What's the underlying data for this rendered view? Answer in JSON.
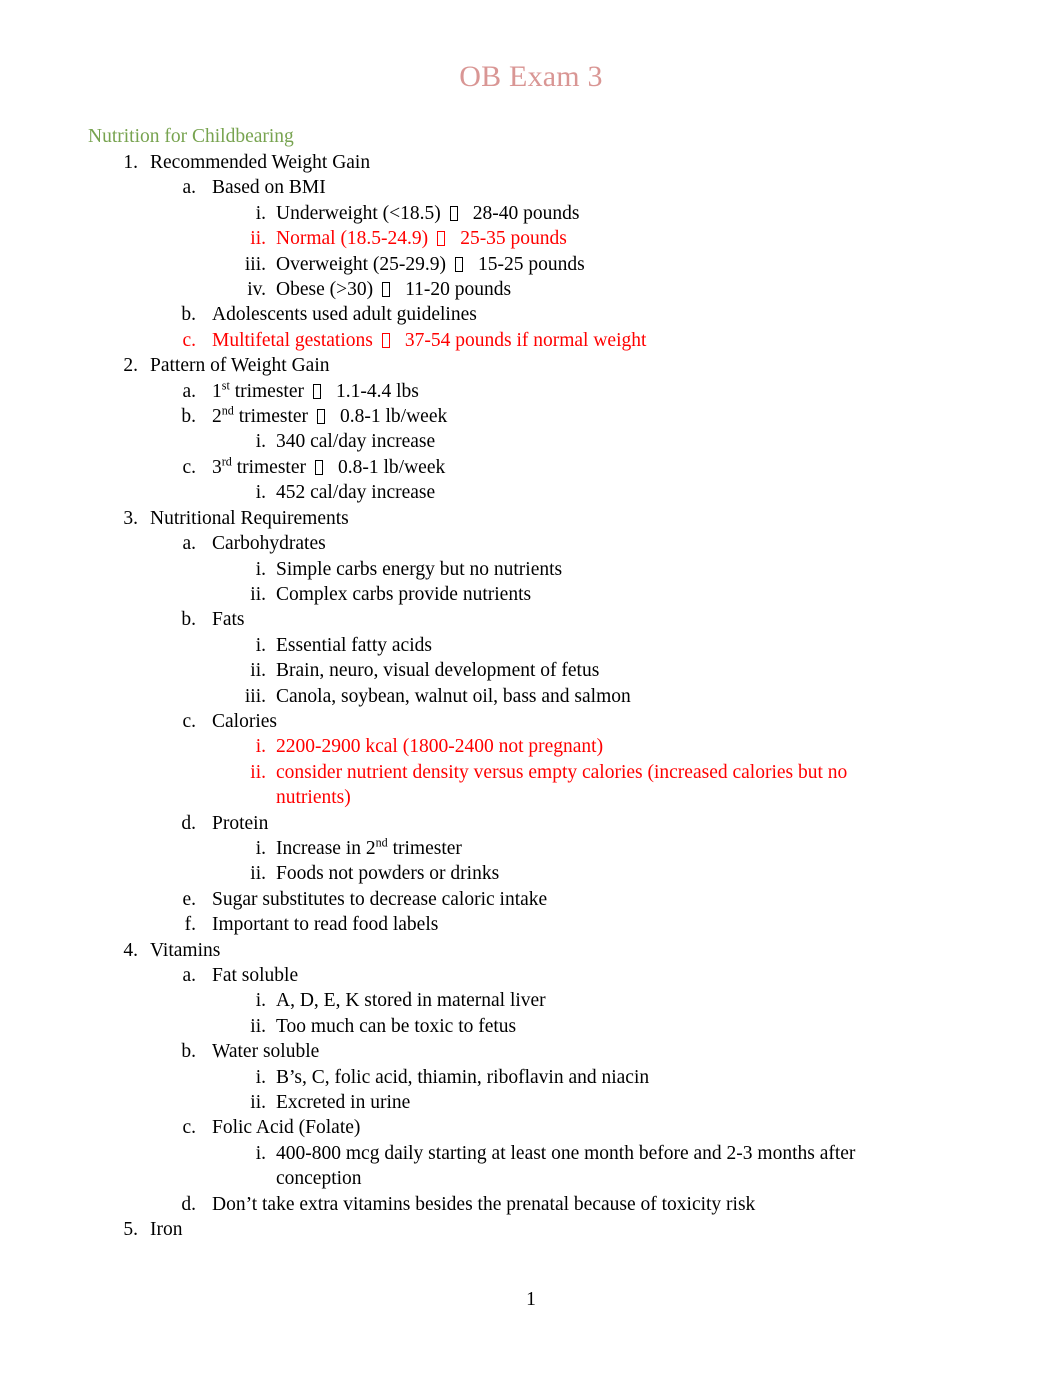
{
  "document": {
    "title": "OB Exam 3",
    "title_color": "#d99694",
    "heading_color": "#77a34f",
    "highlight_color": "#ff0000",
    "page_number": "1"
  },
  "heading": {
    "text": "Nutrition for Childbearing"
  },
  "arrow_glyph": {
    "name": "missing-glyph-box",
    "description": "unrenderable Wingdings arrow shown as empty box"
  },
  "outline": [
    {
      "marker": "1.",
      "level": 1,
      "text": "Recommended Weight Gain",
      "color": "black",
      "children": [
        {
          "marker": "a.",
          "level": 2,
          "text": "Based on BMI",
          "color": "black",
          "children": [
            {
              "marker": "i.",
              "level": 3,
              "color": "black",
              "before_arrow": "Underweight (<18.5)",
              "after_arrow": "28-40 pounds"
            },
            {
              "marker": "ii.",
              "level": 3,
              "color": "red",
              "before_arrow": "Normal (18.5-24.9)",
              "after_arrow": "25-35 pounds"
            },
            {
              "marker": "iii.",
              "level": 3,
              "color": "black",
              "before_arrow": "Overweight (25-29.9)",
              "after_arrow": "15-25 pounds"
            },
            {
              "marker": "iv.",
              "level": 3,
              "color": "black",
              "before_arrow": "Obese (>30)",
              "after_arrow": "11-20 pounds"
            }
          ]
        },
        {
          "marker": "b.",
          "level": 2,
          "text": "Adolescents used adult guidelines",
          "color": "black"
        },
        {
          "marker": "c.",
          "level": 2,
          "color": "red",
          "before_arrow": "Multifetal gestations",
          "after_arrow": "37-54 pounds if normal weight"
        }
      ]
    },
    {
      "marker": "2.",
      "level": 1,
      "text": "Pattern of Weight Gain",
      "color": "black",
      "children": [
        {
          "marker": "a.",
          "level": 2,
          "color": "black",
          "ordinal_base": "1",
          "ordinal_sup": "st",
          "before_arrow": " trimester",
          "after_arrow": "1.1-4.4 lbs"
        },
        {
          "marker": "b.",
          "level": 2,
          "color": "black",
          "ordinal_base": "2",
          "ordinal_sup": "nd",
          "before_arrow": " trimester",
          "after_arrow": "0.8-1 lb/week",
          "children": [
            {
              "marker": "i.",
              "level": 3,
              "text": "340 cal/day increase",
              "color": "black"
            }
          ]
        },
        {
          "marker": "c.",
          "level": 2,
          "color": "black",
          "ordinal_base": "3",
          "ordinal_sup": "rd",
          "before_arrow": " trimester",
          "after_arrow": "0.8-1 lb/week",
          "children": [
            {
              "marker": "i.",
              "level": 3,
              "text": "452 cal/day increase",
              "color": "black"
            }
          ]
        }
      ]
    },
    {
      "marker": "3.",
      "level": 1,
      "text": "Nutritional Requirements",
      "color": "black",
      "children": [
        {
          "marker": "a.",
          "level": 2,
          "text": "Carbohydrates",
          "color": "black",
          "children": [
            {
              "marker": "i.",
              "level": 3,
              "text": "Simple carbs energy but no nutrients",
              "color": "black"
            },
            {
              "marker": "ii.",
              "level": 3,
              "text": "Complex carbs provide nutrients",
              "color": "black"
            }
          ]
        },
        {
          "marker": "b.",
          "level": 2,
          "text": "Fats",
          "color": "black",
          "children": [
            {
              "marker": "i.",
              "level": 3,
              "text": "Essential fatty acids",
              "color": "black"
            },
            {
              "marker": "ii.",
              "level": 3,
              "text": "Brain, neuro, visual development of fetus",
              "color": "black"
            },
            {
              "marker": "iii.",
              "level": 3,
              "text": "Canola, soybean, walnut oil, bass and salmon",
              "color": "black"
            }
          ]
        },
        {
          "marker": "c.",
          "level": 2,
          "text": "Calories",
          "color": "black",
          "children": [
            {
              "marker": "i.",
              "level": 3,
              "text": "2200-2900 kcal (1800-2400 not pregnant)",
              "color": "red"
            },
            {
              "marker": "ii.",
              "level": 3,
              "text": "consider nutrient density versus empty calories (increased calories but no nutrients)",
              "color": "red"
            }
          ]
        },
        {
          "marker": "d.",
          "level": 2,
          "text": "Protein",
          "color": "black",
          "children": [
            {
              "marker": "i.",
              "level": 3,
              "color": "black",
              "text_before_sup": "Increase in 2",
              "sup": "nd",
              "text_after_sup": " trimester"
            },
            {
              "marker": "ii.",
              "level": 3,
              "text": "Foods not powders or drinks",
              "color": "black"
            }
          ]
        },
        {
          "marker": "e.",
          "level": 2,
          "text": "Sugar substitutes to decrease caloric intake",
          "color": "black"
        },
        {
          "marker": "f.",
          "level": 2,
          "text": "Important to read food labels",
          "color": "black"
        }
      ]
    },
    {
      "marker": "4.",
      "level": 1,
      "text": "Vitamins",
      "color": "black",
      "children": [
        {
          "marker": "a.",
          "level": 2,
          "text": "Fat soluble",
          "color": "black",
          "children": [
            {
              "marker": "i.",
              "level": 3,
              "text": "A, D, E, K stored in maternal liver",
              "color": "black"
            },
            {
              "marker": "ii.",
              "level": 3,
              "text": "Too much can be toxic to fetus",
              "color": "black"
            }
          ]
        },
        {
          "marker": "b.",
          "level": 2,
          "text": "Water soluble",
          "color": "black",
          "children": [
            {
              "marker": "i.",
              "level": 3,
              "text": "B’s, C, folic acid, thiamin, riboflavin and niacin",
              "color": "black"
            },
            {
              "marker": "ii.",
              "level": 3,
              "text": "Excreted in urine",
              "color": "black"
            }
          ]
        },
        {
          "marker": "c.",
          "level": 2,
          "text": "Folic Acid (Folate)",
          "color": "black",
          "children": [
            {
              "marker": "i.",
              "level": 3,
              "text": "400-800 mcg daily starting at least one month before and 2-3 months after conception",
              "color": "black"
            }
          ]
        },
        {
          "marker": "d.",
          "level": 2,
          "text": "Don’t take extra vitamins besides the prenatal because of toxicity risk",
          "color": "black"
        }
      ]
    },
    {
      "marker": "5.",
      "level": 1,
      "text": "Iron",
      "color": "black"
    }
  ]
}
